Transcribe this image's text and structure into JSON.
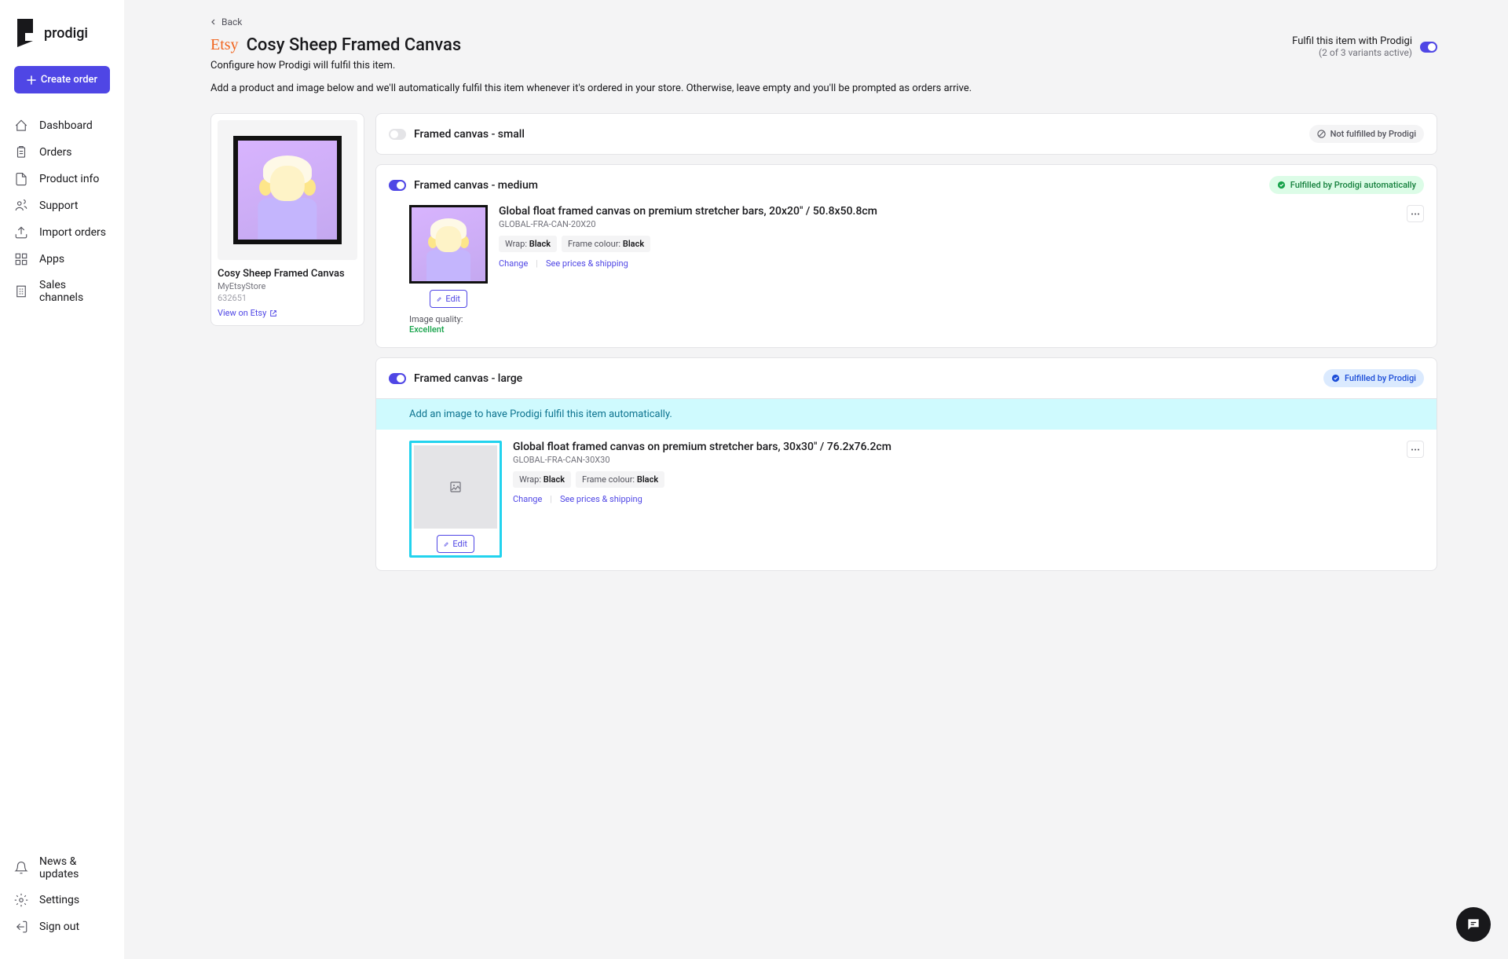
{
  "brand": {
    "name": "prodigi"
  },
  "sidebar": {
    "create_label": "Create order",
    "nav": [
      {
        "label": "Dashboard"
      },
      {
        "label": "Orders"
      },
      {
        "label": "Product info"
      },
      {
        "label": "Support"
      },
      {
        "label": "Import orders"
      },
      {
        "label": "Apps"
      },
      {
        "label": "Sales channels"
      }
    ],
    "bottom": [
      {
        "label": "News & updates"
      },
      {
        "label": "Settings"
      },
      {
        "label": "Sign out"
      }
    ]
  },
  "page": {
    "back_label": "Back",
    "source_label": "Etsy",
    "title": "Cosy Sheep Framed Canvas",
    "subtitle": "Configure how Prodigi will fulfil this item.",
    "description": "Add a product and image below and we'll automatically fulfil this item whenever it's ordered in your store. Otherwise, leave empty and you'll be prompted as orders arrive.",
    "fulfil": {
      "label": "Fulfil this item with Prodigi",
      "sub": "(2 of 3 variants active)"
    }
  },
  "product": {
    "name": "Cosy Sheep Framed Canvas",
    "store": "MyEtsyStore",
    "id": "632651",
    "link_label": "View on Etsy"
  },
  "variants": [
    {
      "active": false,
      "name": "Framed canvas - small",
      "badge": {
        "type": "not-fulfilled",
        "label": "Not fulfilled by Prodigi"
      }
    },
    {
      "active": true,
      "name": "Framed canvas - medium",
      "badge": {
        "type": "auto",
        "label": "Fulfilled by Prodigi automatically"
      },
      "product": {
        "title": "Global float framed canvas on premium stretcher bars, 20x20\" / 50.8x50.8cm",
        "sku": "GLOBAL-FRA-CAN-20X20",
        "tags": [
          {
            "label": "Wrap:",
            "value": "Black"
          },
          {
            "label": "Frame colour:",
            "value": "Black"
          }
        ],
        "change_label": "Change",
        "prices_label": "See prices & shipping",
        "edit_label": "Edit",
        "quality_label": "Image quality:",
        "quality_value": "Excellent"
      }
    },
    {
      "active": true,
      "name": "Framed canvas - large",
      "badge": {
        "type": "prodigi",
        "label": "Fulfilled by Prodigi"
      },
      "info": "Add an image to have Prodigi fulfil this item automatically.",
      "product": {
        "title": "Global float framed canvas on premium stretcher bars, 30x30\" / 76.2x76.2cm",
        "sku": "GLOBAL-FRA-CAN-30X30",
        "tags": [
          {
            "label": "Wrap:",
            "value": "Black"
          },
          {
            "label": "Frame colour:",
            "value": "Black"
          }
        ],
        "change_label": "Change",
        "prices_label": "See prices & shipping",
        "edit_label": "Edit"
      }
    }
  ]
}
